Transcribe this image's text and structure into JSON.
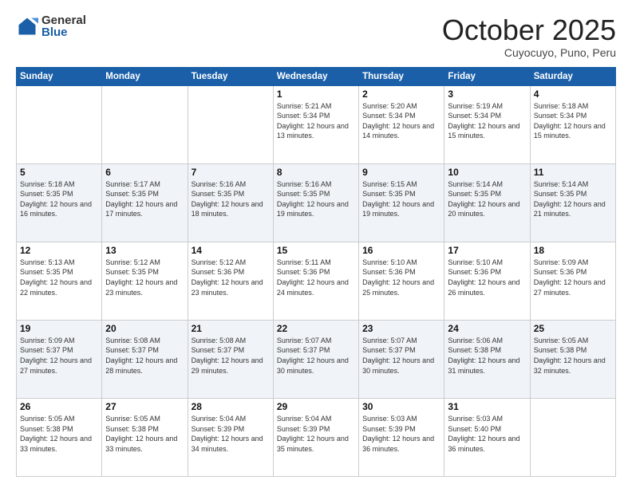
{
  "logo": {
    "general": "General",
    "blue": "Blue"
  },
  "header": {
    "month": "October 2025",
    "location": "Cuyocuyo, Puno, Peru"
  },
  "weekdays": [
    "Sunday",
    "Monday",
    "Tuesday",
    "Wednesday",
    "Thursday",
    "Friday",
    "Saturday"
  ],
  "weeks": [
    [
      {
        "day": "",
        "info": ""
      },
      {
        "day": "",
        "info": ""
      },
      {
        "day": "",
        "info": ""
      },
      {
        "day": "1",
        "info": "Sunrise: 5:21 AM\nSunset: 5:34 PM\nDaylight: 12 hours and 13 minutes."
      },
      {
        "day": "2",
        "info": "Sunrise: 5:20 AM\nSunset: 5:34 PM\nDaylight: 12 hours and 14 minutes."
      },
      {
        "day": "3",
        "info": "Sunrise: 5:19 AM\nSunset: 5:34 PM\nDaylight: 12 hours and 15 minutes."
      },
      {
        "day": "4",
        "info": "Sunrise: 5:18 AM\nSunset: 5:34 PM\nDaylight: 12 hours and 15 minutes."
      }
    ],
    [
      {
        "day": "5",
        "info": "Sunrise: 5:18 AM\nSunset: 5:35 PM\nDaylight: 12 hours and 16 minutes."
      },
      {
        "day": "6",
        "info": "Sunrise: 5:17 AM\nSunset: 5:35 PM\nDaylight: 12 hours and 17 minutes."
      },
      {
        "day": "7",
        "info": "Sunrise: 5:16 AM\nSunset: 5:35 PM\nDaylight: 12 hours and 18 minutes."
      },
      {
        "day": "8",
        "info": "Sunrise: 5:16 AM\nSunset: 5:35 PM\nDaylight: 12 hours and 19 minutes."
      },
      {
        "day": "9",
        "info": "Sunrise: 5:15 AM\nSunset: 5:35 PM\nDaylight: 12 hours and 19 minutes."
      },
      {
        "day": "10",
        "info": "Sunrise: 5:14 AM\nSunset: 5:35 PM\nDaylight: 12 hours and 20 minutes."
      },
      {
        "day": "11",
        "info": "Sunrise: 5:14 AM\nSunset: 5:35 PM\nDaylight: 12 hours and 21 minutes."
      }
    ],
    [
      {
        "day": "12",
        "info": "Sunrise: 5:13 AM\nSunset: 5:35 PM\nDaylight: 12 hours and 22 minutes."
      },
      {
        "day": "13",
        "info": "Sunrise: 5:12 AM\nSunset: 5:35 PM\nDaylight: 12 hours and 23 minutes."
      },
      {
        "day": "14",
        "info": "Sunrise: 5:12 AM\nSunset: 5:36 PM\nDaylight: 12 hours and 23 minutes."
      },
      {
        "day": "15",
        "info": "Sunrise: 5:11 AM\nSunset: 5:36 PM\nDaylight: 12 hours and 24 minutes."
      },
      {
        "day": "16",
        "info": "Sunrise: 5:10 AM\nSunset: 5:36 PM\nDaylight: 12 hours and 25 minutes."
      },
      {
        "day": "17",
        "info": "Sunrise: 5:10 AM\nSunset: 5:36 PM\nDaylight: 12 hours and 26 minutes."
      },
      {
        "day": "18",
        "info": "Sunrise: 5:09 AM\nSunset: 5:36 PM\nDaylight: 12 hours and 27 minutes."
      }
    ],
    [
      {
        "day": "19",
        "info": "Sunrise: 5:09 AM\nSunset: 5:37 PM\nDaylight: 12 hours and 27 minutes."
      },
      {
        "day": "20",
        "info": "Sunrise: 5:08 AM\nSunset: 5:37 PM\nDaylight: 12 hours and 28 minutes."
      },
      {
        "day": "21",
        "info": "Sunrise: 5:08 AM\nSunset: 5:37 PM\nDaylight: 12 hours and 29 minutes."
      },
      {
        "day": "22",
        "info": "Sunrise: 5:07 AM\nSunset: 5:37 PM\nDaylight: 12 hours and 30 minutes."
      },
      {
        "day": "23",
        "info": "Sunrise: 5:07 AM\nSunset: 5:37 PM\nDaylight: 12 hours and 30 minutes."
      },
      {
        "day": "24",
        "info": "Sunrise: 5:06 AM\nSunset: 5:38 PM\nDaylight: 12 hours and 31 minutes."
      },
      {
        "day": "25",
        "info": "Sunrise: 5:05 AM\nSunset: 5:38 PM\nDaylight: 12 hours and 32 minutes."
      }
    ],
    [
      {
        "day": "26",
        "info": "Sunrise: 5:05 AM\nSunset: 5:38 PM\nDaylight: 12 hours and 33 minutes."
      },
      {
        "day": "27",
        "info": "Sunrise: 5:05 AM\nSunset: 5:38 PM\nDaylight: 12 hours and 33 minutes."
      },
      {
        "day": "28",
        "info": "Sunrise: 5:04 AM\nSunset: 5:39 PM\nDaylight: 12 hours and 34 minutes."
      },
      {
        "day": "29",
        "info": "Sunrise: 5:04 AM\nSunset: 5:39 PM\nDaylight: 12 hours and 35 minutes."
      },
      {
        "day": "30",
        "info": "Sunrise: 5:03 AM\nSunset: 5:39 PM\nDaylight: 12 hours and 36 minutes."
      },
      {
        "day": "31",
        "info": "Sunrise: 5:03 AM\nSunset: 5:40 PM\nDaylight: 12 hours and 36 minutes."
      },
      {
        "day": "",
        "info": ""
      }
    ]
  ]
}
